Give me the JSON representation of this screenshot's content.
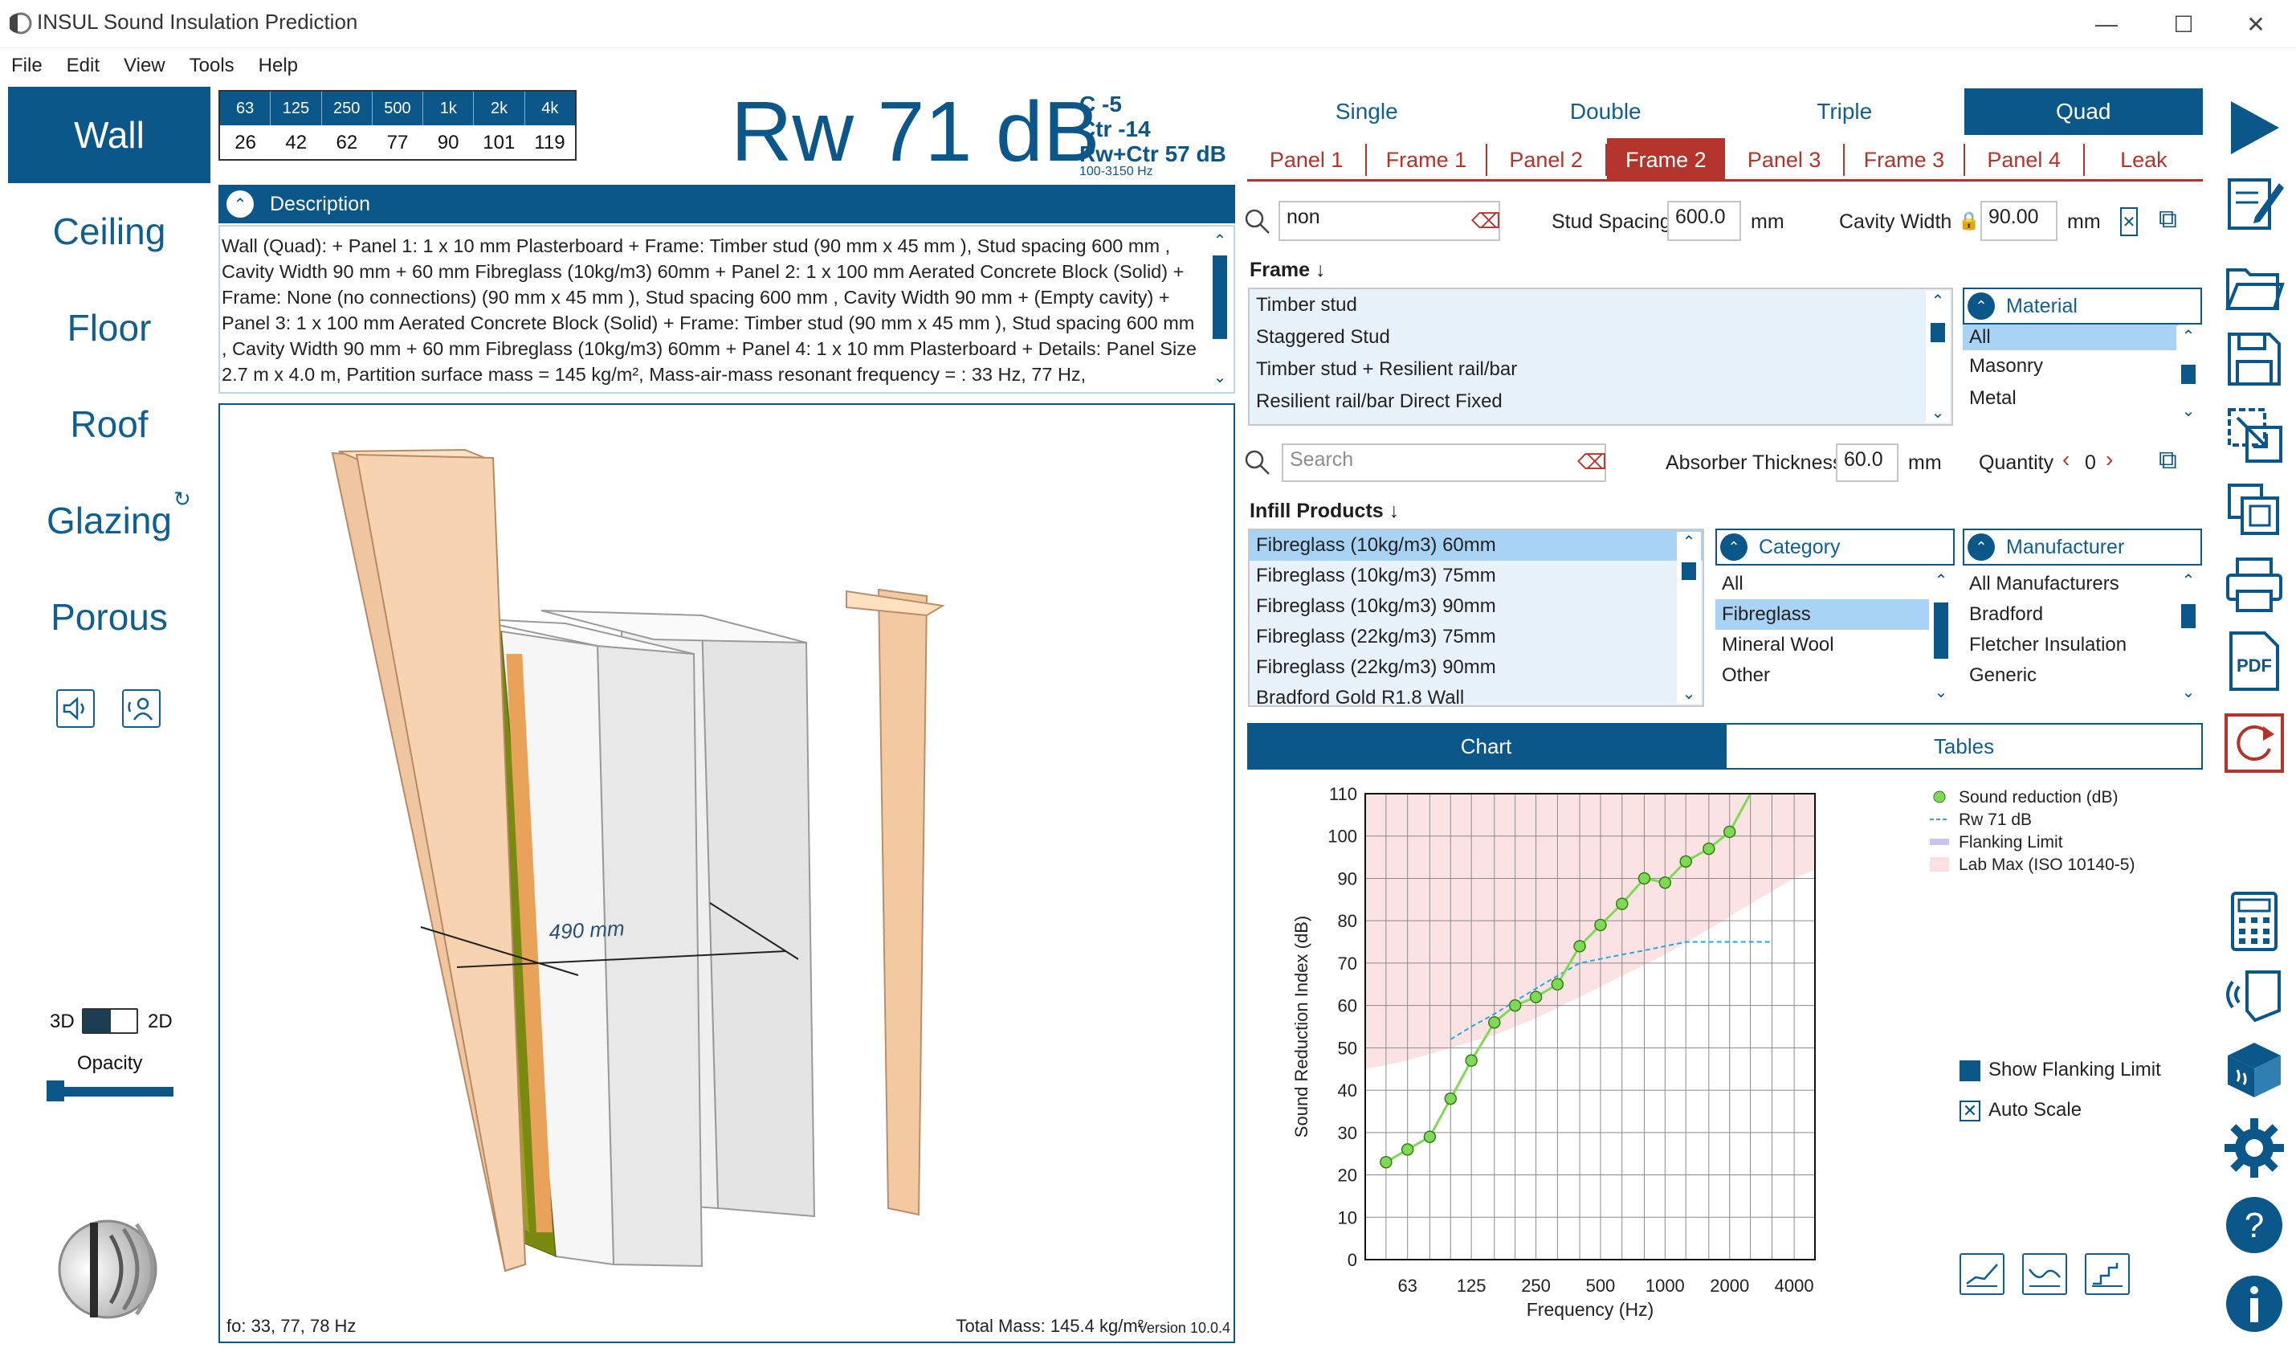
{
  "window": {
    "title": "INSUL Sound Insulation Prediction"
  },
  "menu": [
    "File",
    "Edit",
    "View",
    "Tools",
    "Help"
  ],
  "nav": {
    "items": [
      "Wall",
      "Ceiling",
      "Floor",
      "Roof",
      "Glazing",
      "Porous"
    ],
    "active": "Wall",
    "view_3d": "3D",
    "view_2d": "2D",
    "opacity_label": "Opacity",
    "opacity_value": 0.05
  },
  "freq_table": {
    "bands": [
      "63",
      "125",
      "250",
      "500",
      "1k",
      "2k",
      "4k"
    ],
    "values": [
      "26",
      "42",
      "62",
      "77",
      "90",
      "101",
      "119"
    ]
  },
  "rating": {
    "rw": "Rw 71 dB",
    "c": "C -5",
    "ctr": "Ctr -14",
    "rwctr": "Rw+Ctr 57 dB",
    "range": "100-3150 Hz"
  },
  "description": {
    "title": "Description",
    "text": "Wall (Quad):  + Panel 1: 1 x 10 mm Plasterboard + Frame: Timber stud (90 mm x 45 mm ), Stud spacing  600 mm , Cavity Width 90 mm  + 60 mm  Fibreglass (10kg/m3) 60mm + Panel 2: 1 x 100 mm Aerated Concrete Block (Solid) + Frame: None (no connections) (90 mm x 45 mm ), Stud spacing  600 mm , Cavity Width 90 mm  +  (Empty cavity) + Panel 3: 1 x 100 mm Aerated Concrete Block (Solid) + Frame: Timber stud (90 mm x 45 mm ), Stud spacing  600 mm , Cavity Width 90 mm  + 60 mm  Fibreglass (10kg/m3) 60mm + Panel 4: 1 x 10 mm Plasterboard + Details: Panel Size  2.7 m x 4.0 m, Partition surface mass = 145 kg/m², Mass-air-mass resonant frequency = : 33 Hz, 77 Hz,"
  },
  "viewport": {
    "dimension": "490 mm",
    "fo": "fo: 33, 77, 78 Hz",
    "total_mass": "Total Mass: 145.4 kg/m²",
    "version": "Version 10.0.4"
  },
  "config_tabs": {
    "items": [
      "Single",
      "Double",
      "Triple",
      "Quad"
    ],
    "active": "Quad"
  },
  "element_tabs": {
    "items": [
      "Panel 1",
      "Frame 1",
      "Panel 2",
      "Frame 2",
      "Panel 3",
      "Frame 3",
      "Panel 4",
      "Leak"
    ],
    "active": "Frame 2"
  },
  "frame": {
    "search_value": "non",
    "stud_spacing_label": "Stud Spacing",
    "stud_spacing": "600.0",
    "cavity_width_label": "Cavity Width",
    "cavity_width": "90.00",
    "unit": "mm",
    "section_label": "Frame",
    "list": [
      "Timber stud",
      "Staggered Stud",
      "Timber stud + Resilient rail/bar",
      "Resilient rail/bar Direct Fixed"
    ],
    "material_label": "Material",
    "materials": [
      "All",
      "Masonry",
      "Metal"
    ],
    "material_selected": "All"
  },
  "infill": {
    "search_placeholder": "Search",
    "absorber_label": "Absorber Thickness",
    "absorber_value": "60.0",
    "unit": "mm",
    "quantity_label": "Quantity",
    "quantity_value": "0",
    "section_label": "Infill Products",
    "products": [
      "Fibreglass (10kg/m3) 60mm",
      "Fibreglass (10kg/m3) 75mm",
      "Fibreglass (10kg/m3) 90mm",
      "Fibreglass (22kg/m3) 75mm",
      "Fibreglass (22kg/m3) 90mm",
      "Bradford Gold R1.8 Wall"
    ],
    "product_selected": "Fibreglass (10kg/m3) 60mm",
    "category_label": "Category",
    "categories": [
      "All",
      "Fibreglass",
      "Mineral Wool",
      "Other"
    ],
    "category_selected": "Fibreglass",
    "manufacturer_label": "Manufacturer",
    "manufacturers": [
      "All Manufacturers",
      "Bradford",
      "Fletcher Insulation",
      "Generic"
    ]
  },
  "chart_tabs": {
    "items": [
      "Chart",
      "Tables"
    ],
    "active": "Chart"
  },
  "options": {
    "show_flanking": "Show Flanking Limit",
    "show_flanking_checked": false,
    "auto_scale": "Auto Scale",
    "auto_scale_checked": true
  },
  "colors": {
    "accent": "#0b5789",
    "element_tabs": "#b3342b",
    "sound_reduction": "#7ed957",
    "rw_curve": "#29a8e0",
    "flanking": "#c9c3f0",
    "lab_max": "#fbe0e0"
  },
  "chart_data": {
    "type": "line",
    "xlabel": "Frequency (Hz)",
    "ylabel": "Sound Reduction Index (dB)",
    "x_ticks": [
      "63",
      "125",
      "250",
      "500",
      "1000",
      "2000",
      "4000"
    ],
    "xlim": [
      40,
      5000
    ],
    "ylim": [
      0,
      110
    ],
    "y_ticks": [
      0,
      10,
      20,
      30,
      40,
      50,
      60,
      70,
      80,
      90,
      100,
      110
    ],
    "x_scale": "log",
    "grid": true,
    "legend_position": "top-right",
    "series": [
      {
        "name": "Sound reduction (dB)",
        "x": [
          50,
          63,
          80,
          100,
          125,
          160,
          200,
          250,
          315,
          400,
          500,
          630,
          800,
          1000,
          1250,
          1600,
          2000,
          2500
        ],
        "y": [
          23,
          26,
          29,
          38,
          47,
          56,
          60,
          62,
          65,
          74,
          79,
          84,
          90,
          89,
          94,
          97,
          101,
          110
        ]
      },
      {
        "name": "Rw 71 dB",
        "x": [
          100,
          125,
          160,
          200,
          250,
          315,
          400,
          500,
          630,
          800,
          1000,
          1250,
          1600,
          2000,
          2500,
          3150
        ],
        "y": [
          52,
          55,
          58,
          61,
          64,
          67,
          70,
          71,
          72,
          73,
          74,
          75,
          75,
          75,
          75,
          75
        ]
      },
      {
        "name": "Flanking Limit",
        "x": [],
        "y": []
      },
      {
        "name": "Lab Max (ISO 10140-5)",
        "x": [
          40,
          63,
          100,
          160,
          250,
          400,
          630,
          1000,
          1600,
          2500,
          4000,
          5000
        ],
        "y": [
          45,
          47,
          50,
          53,
          57,
          62,
          67,
          72,
          78,
          84,
          90,
          92
        ]
      }
    ]
  }
}
